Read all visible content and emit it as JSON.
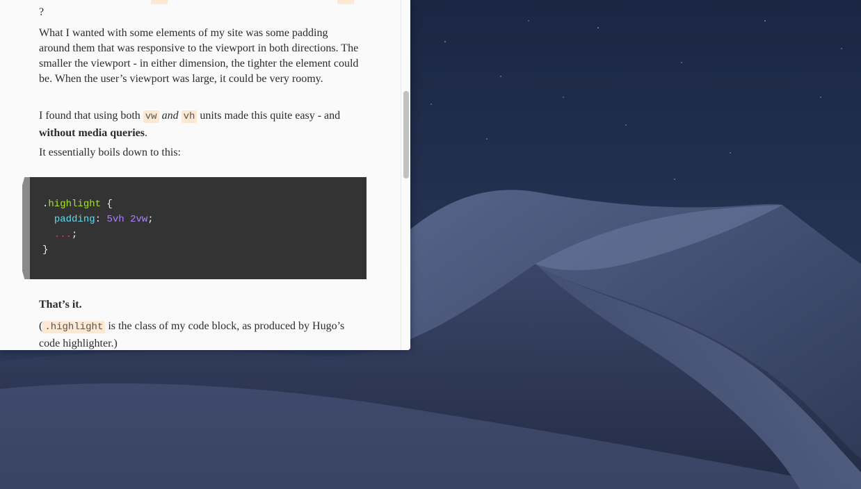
{
  "page": {
    "top_fragment": "?",
    "para1": "What I wanted with some elements of my site was some padding around them that was responsive to the viewport in both directions. The smaller the viewport - in either dimension, the tighter the element could be. When the user’s viewport was large, it could be very roomy.",
    "para2": {
      "t1": "I found that using both ",
      "code1": "vw",
      "em": "and",
      "code2": "vh",
      "t2": " units made this quite easy - and ",
      "strong": "without media queries",
      "t3": "."
    },
    "para3": "It essentially boils down to this:",
    "code_block": {
      "line1_dot": ".",
      "line1_sel": "highlight",
      "line1_brace": " {",
      "line2_prop": "padding",
      "line2_colon": ": ",
      "line2_val1": "5vh",
      "line2_val2": "2vw",
      "line2_semi": ";",
      "line3_dots": "...",
      "line3_semi": ";",
      "line4": "}"
    },
    "para4": "That’s it.",
    "para5": {
      "open": "(",
      "code": ".highlight",
      "rest": " is the class of my code block, as produced by Hugo’s code highlighter.)"
    }
  },
  "colors": {
    "inline_code_bg": "#fde8d2",
    "code_block_bg": "#333333",
    "selector": "#a6e22e",
    "property": "#66d9ef",
    "number": "#ae81ff",
    "punctuation_accent": "#f92672"
  }
}
